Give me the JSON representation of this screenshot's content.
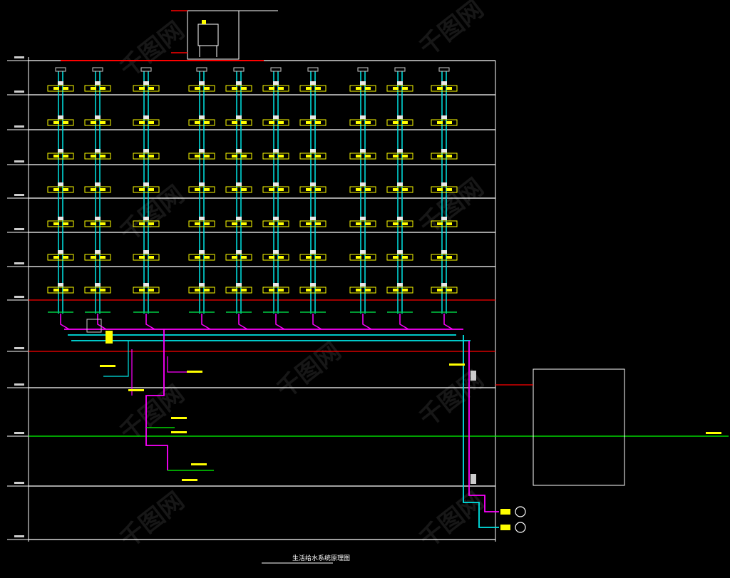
{
  "drawing": {
    "title": "生活给水系统原理图",
    "watermark": "千图网",
    "colors": {
      "background": "#000000",
      "frame": "#ffffff",
      "hot_water": "#00e5e5",
      "cold_water": "#ff00ff",
      "fixture": "#ffff00",
      "floor_red": "#ff0000",
      "ground": "#00ff00",
      "branch_green": "#00cc44"
    },
    "icons": [
      "pipe-riser",
      "valve",
      "fixture-box",
      "pump",
      "water-tank",
      "meter"
    ]
  }
}
